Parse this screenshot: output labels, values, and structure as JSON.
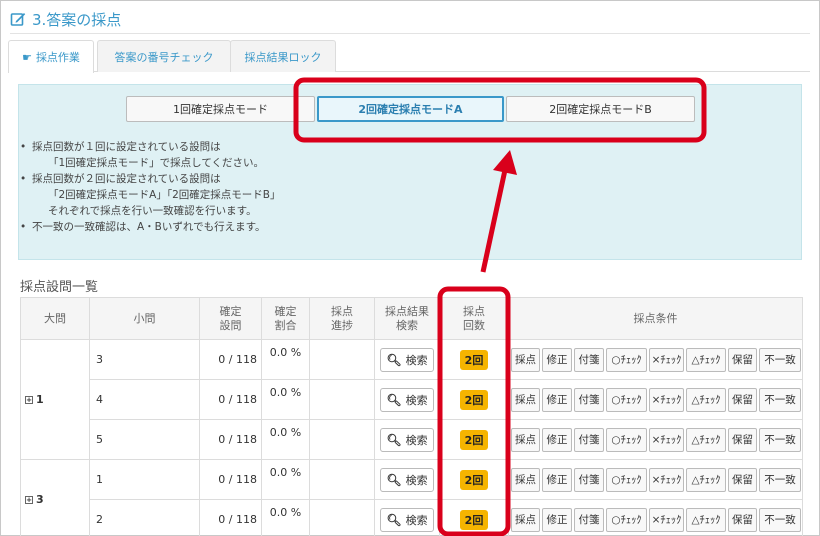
{
  "section": {
    "title": "3.答案の採点"
  },
  "tabs": [
    {
      "label": "採点作業"
    },
    {
      "label": "答案の番号チェック"
    },
    {
      "label": "採点結果ロック"
    }
  ],
  "modes": [
    {
      "label": "1回確定採点モード"
    },
    {
      "label": "2回確定採点モードA"
    },
    {
      "label": "2回確定採点モードB"
    }
  ],
  "notes": [
    "採点回数が１回に設定されている設問は",
    "「1回確定採点モード」で採点してください。",
    "採点回数が２回に設定されている設問は",
    "「2回確定採点モードA」「2回確定採点モードB」",
    "それぞれで採点を行い一致確認を行います。",
    "不一致の一致確認は、A・Bいずれでも行えます。"
  ],
  "list": {
    "title": "採点設問一覧",
    "headers": {
      "big": "大問",
      "small": "小問",
      "confirmed_1": "確定",
      "confirmed_2": "設問",
      "ratio_1": "確定",
      "ratio_2": "割合",
      "progress_1": "採点",
      "progress_2": "進捗",
      "search_1": "採点結果",
      "search_2": "検索",
      "count_1": "採点",
      "count_2": "回数",
      "conditions": "採点条件"
    },
    "search_label": "検索",
    "count_badge": "2回",
    "condition_buttons": [
      "採点",
      "修正",
      "付箋",
      "○ﾁｪｯｸ",
      "×ﾁｪｯｸ",
      "△ﾁｪｯｸ",
      "保留",
      "不一致"
    ],
    "groups": [
      {
        "big": "1",
        "rows": [
          {
            "small": "3",
            "ratio": "0 / 118",
            "pct": "0.0 %"
          },
          {
            "small": "4",
            "ratio": "0 / 118",
            "pct": "0.0 %"
          },
          {
            "small": "5",
            "ratio": "0 / 118",
            "pct": "0.0 %"
          }
        ]
      },
      {
        "big": "3",
        "rows": [
          {
            "small": "1",
            "ratio": "0 / 118",
            "pct": "0.0 %"
          },
          {
            "small": "2",
            "ratio": "0 / 118",
            "pct": "0.0 %"
          }
        ]
      }
    ]
  },
  "colors": {
    "accent": "#3a98c9",
    "highlight": "#d9001b",
    "badge": "#f5b400",
    "panel": "#dff1f4"
  }
}
